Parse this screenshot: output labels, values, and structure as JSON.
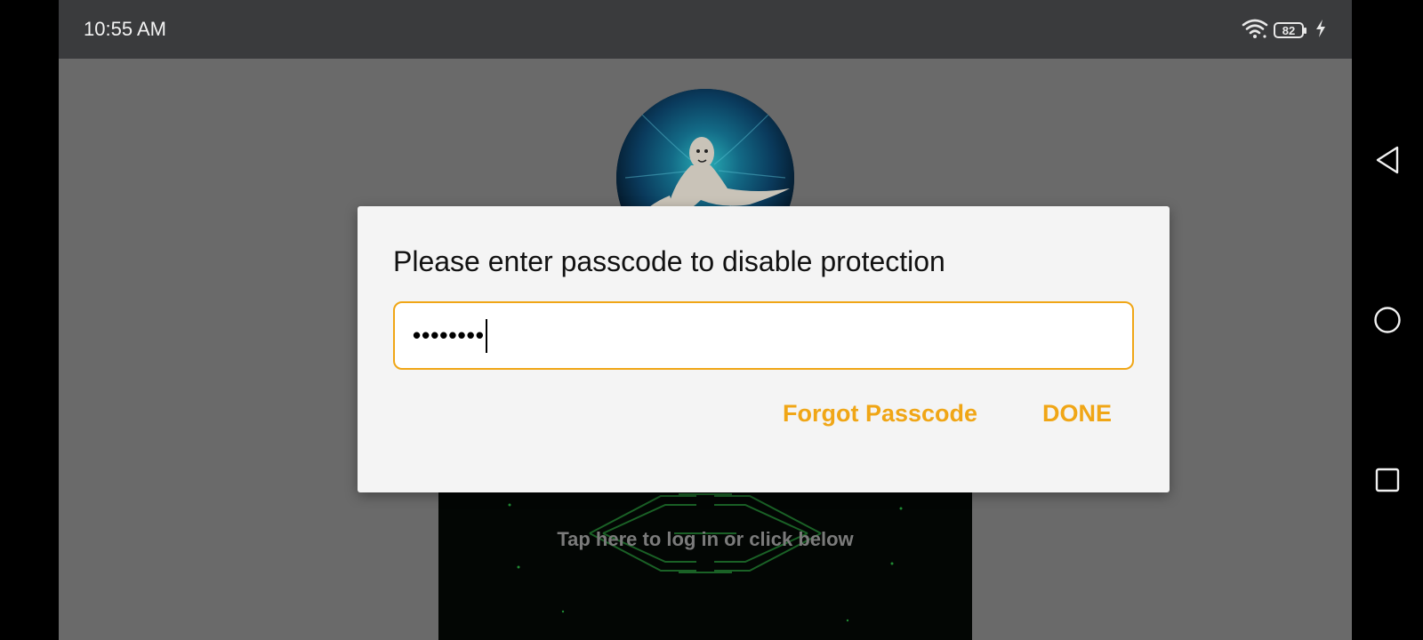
{
  "status_bar": {
    "time": "10:55 AM",
    "battery": "82",
    "icons": [
      "wifi-icon",
      "battery-icon",
      "charging-icon"
    ]
  },
  "background": {
    "login_prompt": "Tap here to log in or click below"
  },
  "dialog": {
    "title": "Please enter passcode to disable protection",
    "passcode_value": "••••••••",
    "forgot_label": "Forgot Passcode",
    "done_label": "DONE",
    "accent_color": "#f0a616"
  },
  "nav_bar": {
    "icons": [
      "back-icon",
      "home-icon",
      "recents-icon"
    ]
  }
}
